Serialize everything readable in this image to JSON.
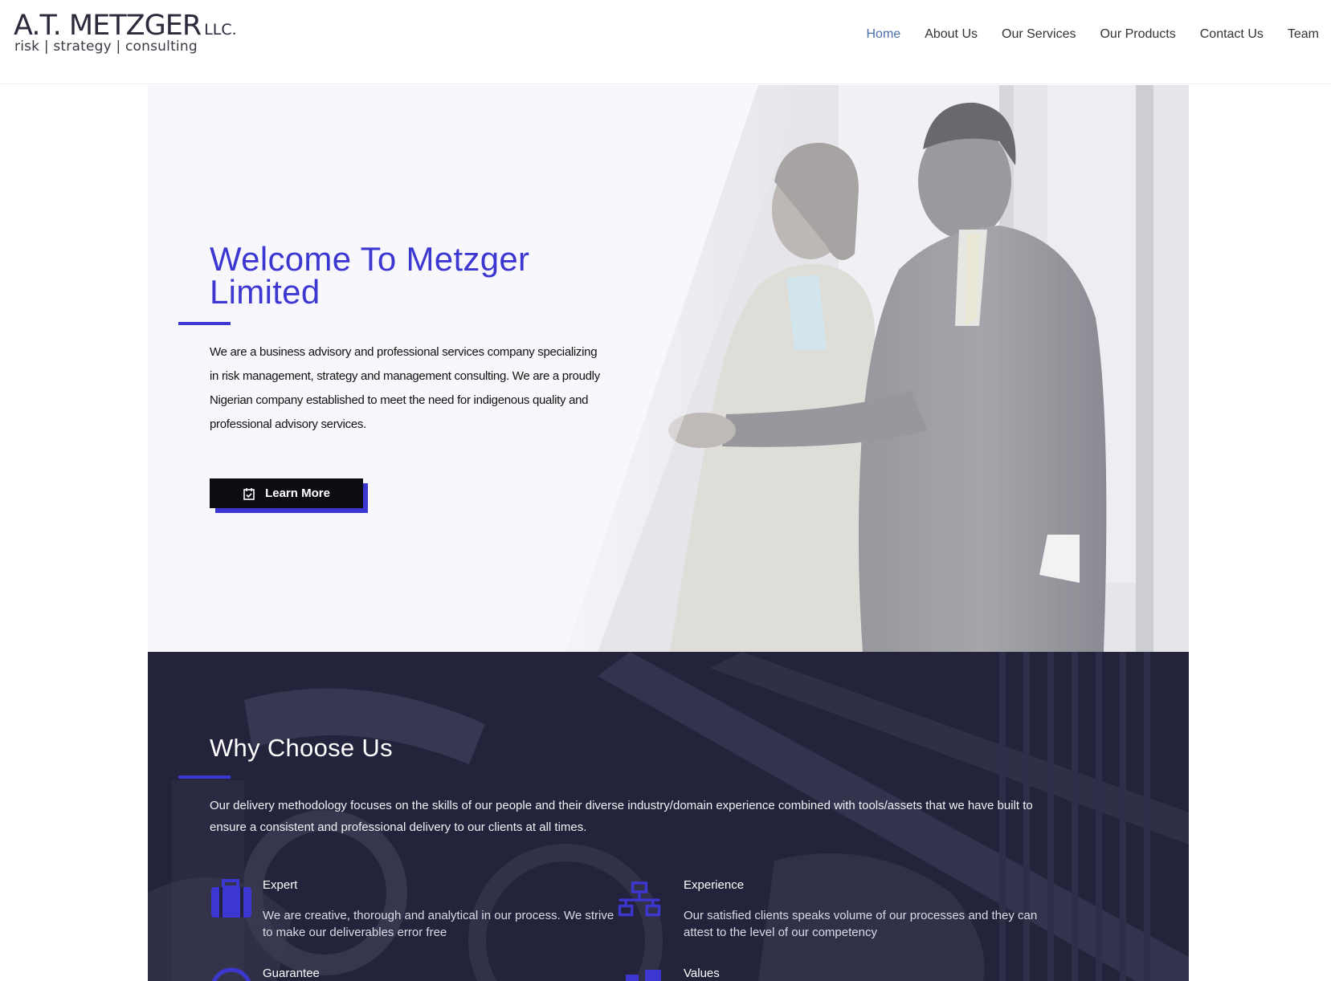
{
  "header": {
    "logo_name": "A.T. METZGER",
    "logo_suffix": "LLC.",
    "logo_tagline": "risk | strategy | consulting",
    "nav": [
      {
        "label": "Home",
        "active": true
      },
      {
        "label": "About Us"
      },
      {
        "label": "Our Services"
      },
      {
        "label": "Our Products"
      },
      {
        "label": "Contact Us"
      },
      {
        "label": "Team"
      }
    ]
  },
  "hero": {
    "title": "Welcome To Metzger Limited",
    "text": "We are a business advisory and professional services company specializing in risk management, strategy and management consulting. We are a proudly Nigerian company established to meet the need for indigenous quality and professional advisory services.",
    "button_label": "Learn More",
    "button_icon": "calendar-check-icon",
    "accent_color": "#3d37d2"
  },
  "why": {
    "title": "Why Choose Us",
    "text": "Our delivery methodology focuses on the skills of our people and their diverse industry/domain experience combined with tools/assets that we have built to ensure a consistent and professional delivery to our clients at all times.",
    "features": [
      {
        "title": "Expert",
        "desc": "We are creative, thorough and analytical in our process. We strive to make our deliverables error free",
        "icon": "briefcase-icon"
      },
      {
        "title": "Experience",
        "desc": "Our satisfied clients speaks volume of our processes and they can attest to the level of our competency",
        "icon": "network-icon"
      },
      {
        "title": "Guarantee",
        "desc": "",
        "icon": "shield-icon"
      },
      {
        "title": "Values",
        "desc": "",
        "icon": "sitemap-icon"
      }
    ],
    "background_color": "#22223a",
    "icon_color": "#3d37d2"
  }
}
